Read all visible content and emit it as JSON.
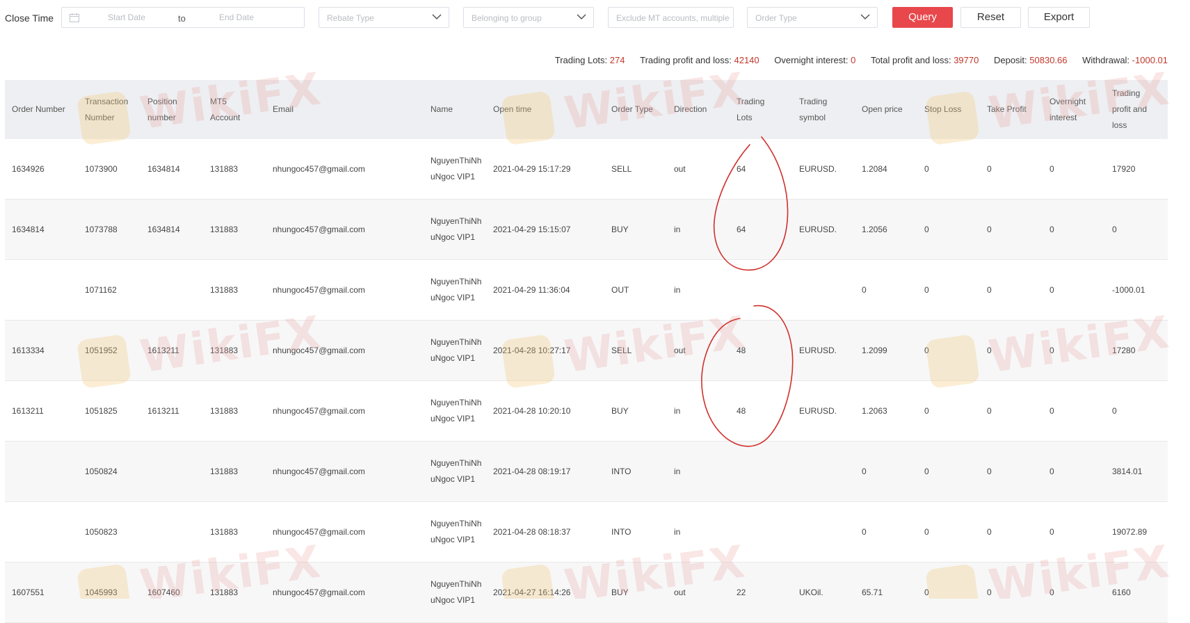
{
  "filters": {
    "close_time_label": "Close Time",
    "start_date_placeholder": "Start Date",
    "to_label": "to",
    "end_date_placeholder": "End Date",
    "rebate_type_placeholder": "Rebate Type",
    "group_placeholder": "Belonging to group",
    "exclude_placeholder": "Exclude MT accounts, multiple",
    "order_type_placeholder": "Order Type",
    "query_label": "Query",
    "reset_label": "Reset",
    "export_label": "Export"
  },
  "summary": [
    {
      "label": "Trading Lots: ",
      "value": "274"
    },
    {
      "label": "Trading profit and loss: ",
      "value": "42140"
    },
    {
      "label": "Overnight interest: ",
      "value": "0"
    },
    {
      "label": "Total profit and loss: ",
      "value": "39770"
    },
    {
      "label": "Deposit: ",
      "value": "50830.66"
    },
    {
      "label": "Withdrawal: ",
      "value": "-1000.01"
    }
  ],
  "table": {
    "headers": [
      "Order Number",
      "Transaction\nNumber",
      "Position\nnumber",
      "MT5\nAccount",
      "Email",
      "Name",
      "Open time",
      "Order Type",
      "Direction",
      "Trading\nLots",
      "Trading\nsymbol",
      "Open price",
      "Stop Loss",
      "Take Profit",
      "Overnight\ninterest",
      "Trading\nprofit and\nloss"
    ],
    "rows": [
      [
        "1634926",
        "1073900",
        "1634814",
        "131883",
        "nhungoc457@gmail.com",
        "NguyenThiNhuNgoc VIP1",
        "2021-04-29 15:17:29",
        "SELL",
        "out",
        "64",
        "EURUSD.",
        "1.2084",
        "0",
        "0",
        "0",
        "17920"
      ],
      [
        "1634814",
        "1073788",
        "1634814",
        "131883",
        "nhungoc457@gmail.com",
        "NguyenThiNhuNgoc VIP1",
        "2021-04-29 15:15:07",
        "BUY",
        "in",
        "64",
        "EURUSD.",
        "1.2056",
        "0",
        "0",
        "0",
        "0"
      ],
      [
        "",
        "1071162",
        "",
        "131883",
        "nhungoc457@gmail.com",
        "NguyenThiNhuNgoc VIP1",
        "2021-04-29 11:36:04",
        "OUT",
        "in",
        "",
        "",
        "0",
        "0",
        "0",
        "0",
        "-1000.01"
      ],
      [
        "1613334",
        "1051952",
        "1613211",
        "131883",
        "nhungoc457@gmail.com",
        "NguyenThiNhuNgoc VIP1",
        "2021-04-28 10:27:17",
        "SELL",
        "out",
        "48",
        "EURUSD.",
        "1.2099",
        "0",
        "0",
        "0",
        "17280"
      ],
      [
        "1613211",
        "1051825",
        "1613211",
        "131883",
        "nhungoc457@gmail.com",
        "NguyenThiNhuNgoc VIP1",
        "2021-04-28 10:20:10",
        "BUY",
        "in",
        "48",
        "EURUSD.",
        "1.2063",
        "0",
        "0",
        "0",
        "0"
      ],
      [
        "",
        "1050824",
        "",
        "131883",
        "nhungoc457@gmail.com",
        "NguyenThiNhuNgoc VIP1",
        "2021-04-28 08:19:17",
        "INTO",
        "in",
        "",
        "",
        "0",
        "0",
        "0",
        "0",
        "3814.01"
      ],
      [
        "",
        "1050823",
        "",
        "131883",
        "nhungoc457@gmail.com",
        "NguyenThiNhuNgoc VIP1",
        "2021-04-28 08:18:37",
        "INTO",
        "in",
        "",
        "",
        "0",
        "0",
        "0",
        "0",
        "19072.89"
      ],
      [
        "1607551",
        "1045993",
        "1607460",
        "131883",
        "nhungoc457@gmail.com",
        "NguyenThiNhuNgoc VIP1",
        "2021-04-27 16:14:26",
        "BUY",
        "out",
        "22",
        "UKOil.",
        "65.71",
        "0",
        "0",
        "0",
        "6160"
      ]
    ]
  },
  "watermark": {
    "text": "WikiFX"
  },
  "colors": {
    "accent": "#e8474b",
    "summary_value": "#c0392b",
    "annotation": "#d0302b"
  }
}
